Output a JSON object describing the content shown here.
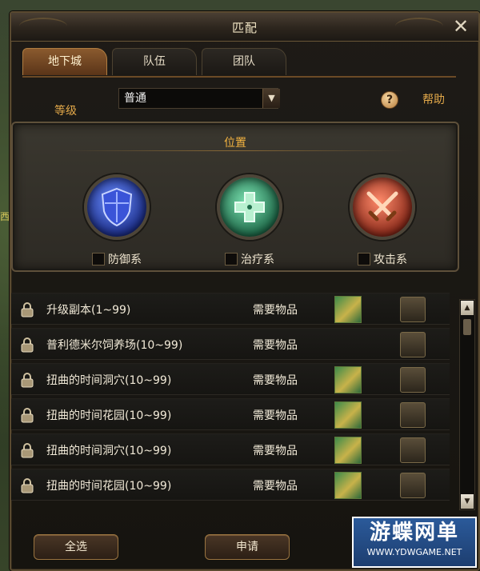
{
  "background": {
    "world_text": "西林"
  },
  "window": {
    "title": "匹配",
    "close_glyph": "✕"
  },
  "tabs": [
    {
      "label": "地下城",
      "active": true
    },
    {
      "label": "队伍",
      "active": false
    },
    {
      "label": "团队",
      "active": false
    }
  ],
  "level": {
    "label": "等级",
    "selected": "普通",
    "arrow_glyph": "▼"
  },
  "help": {
    "icon_glyph": "?",
    "label": "帮助"
  },
  "roles": {
    "title": "位置",
    "items": [
      {
        "label": "防御系",
        "icon": "shield-icon",
        "checked": false
      },
      {
        "label": "治疗系",
        "icon": "cross-icon",
        "checked": false
      },
      {
        "label": "攻击系",
        "icon": "crossed-swords-icon",
        "checked": false
      }
    ]
  },
  "dungeons": [
    {
      "name": "升级副本(1~99)",
      "requirement": "需要物品",
      "has_item": true
    },
    {
      "name": "普利德米尔饲养场(10~99)",
      "requirement": "需要物品",
      "has_item": false
    },
    {
      "name": "扭曲的时间洞穴(10~99)",
      "requirement": "需要物品",
      "has_item": true
    },
    {
      "name": "扭曲的时间花园(10~99)",
      "requirement": "需要物品",
      "has_item": true
    },
    {
      "name": "扭曲的时间洞穴(10~99)",
      "requirement": "需要物品",
      "has_item": true
    },
    {
      "name": "扭曲的时间花园(10~99)",
      "requirement": "需要物品",
      "has_item": true
    }
  ],
  "scroll": {
    "up_glyph": "▲",
    "down_glyph": "▼"
  },
  "buttons": {
    "select_all": "全选",
    "apply": "申请"
  },
  "watermark": {
    "main": "游蝶网单",
    "url": "WWW.YDWGAME.NET"
  },
  "colors": {
    "accent": "#e3a94a",
    "tab_active": "#8a5a2e",
    "title": "#f3b340"
  }
}
